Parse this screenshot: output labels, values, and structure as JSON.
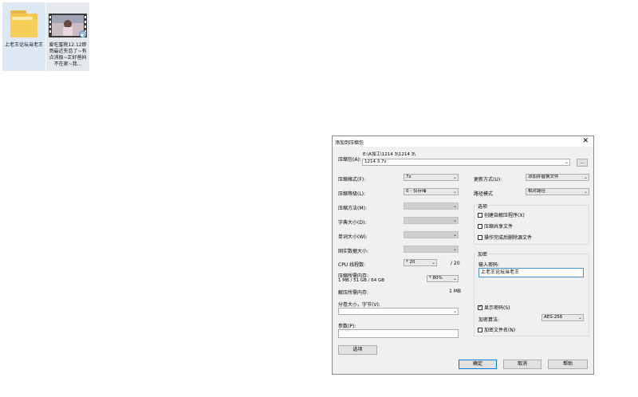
{
  "desktop": {
    "items": [
      {
        "label": "上老王论坛当老王",
        "icon": "folder-icon"
      },
      {
        "label": "爱吃蜜桃12.12即哥最近失恋了~有点消极~正好爸妈不在家~我...",
        "icon": "video-thumbnail-icon"
      }
    ]
  },
  "dialog": {
    "title": "添加到压缩包",
    "close": "✕",
    "archive": {
      "label": "压缩包(A):",
      "path": "E:\\A加工\\1214 3\\1214 3\\",
      "value": "1214 3.7z",
      "browse": "..."
    },
    "left": {
      "format": {
        "label": "压缩格式(F):",
        "value": "7z"
      },
      "level": {
        "label": "压缩等级(L):",
        "value": "0 - 仅存储"
      },
      "method": {
        "label": "压缩方法(M):"
      },
      "dict": {
        "label": "字典大小(D):"
      },
      "word": {
        "label": "单词大小(W):"
      },
      "solid": {
        "label": "固实数据大小:"
      },
      "threads": {
        "label": "CPU 线程数:",
        "value": "* 20",
        "max": "/ 20"
      },
      "memory": {
        "label": "压缩所需内存:",
        "sub": "1 MB / 51 GB / 64 GB",
        "value": "* 80%"
      },
      "decomp": {
        "label": "解压所需内存:",
        "value": "1 MB"
      },
      "split": {
        "label": "分卷大小，字节(V):"
      },
      "params": {
        "label": "参数(P):"
      },
      "options_btn": "选项"
    },
    "right": {
      "update": {
        "label": "更新方式(U):",
        "value": "添加并替换文件"
      },
      "path_mode": {
        "label": "路径模式",
        "value": "相对路径"
      },
      "options": {
        "title": "选项",
        "sfx": "创建自解压程序(X)",
        "shared": "压缩共享文件",
        "delete": "操作完成后删除源文件"
      },
      "encryption": {
        "title": "加密",
        "pwd_label": "输入密码:",
        "pwd_value": "上老王论坛当老王",
        "show_pwd": "显示密码(S)",
        "method_label": "加密算法:",
        "method_value": "AES-256",
        "encrypt_names": "加密文件名(N)"
      }
    },
    "buttons": {
      "ok": "确定",
      "cancel": "取消",
      "help": "帮助"
    }
  }
}
